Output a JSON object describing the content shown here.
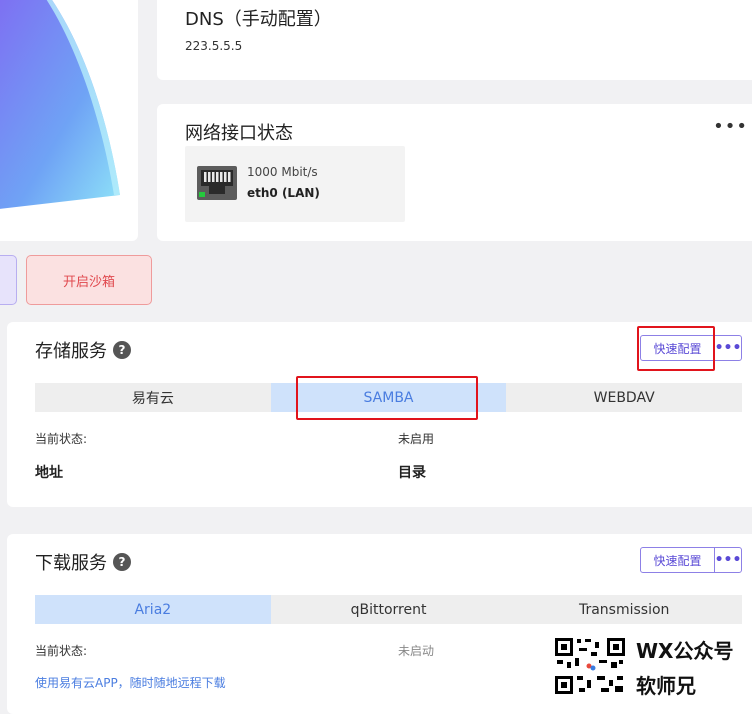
{
  "dns": {
    "title": "DNS（手动配置）",
    "value": "223.5.5.5"
  },
  "network": {
    "title": "网络接口状态",
    "port": {
      "speed": "1000 Mbit/s",
      "name": "eth0 (LAN)"
    }
  },
  "sandbox": {
    "button_label": "开启沙箱"
  },
  "storage": {
    "title": "存储服务",
    "quick_label": "快速配置",
    "tabs": [
      {
        "label": "易有云"
      },
      {
        "label": "SAMBA"
      },
      {
        "label": "WEBDAV"
      }
    ],
    "active_tab": "SAMBA",
    "status_label": "当前状态:",
    "status_value": "未启用",
    "col_address": "地址",
    "col_directory": "目录"
  },
  "download": {
    "title": "下载服务",
    "quick_label": "快速配置",
    "tabs": [
      {
        "label": "Aria2"
      },
      {
        "label": "qBittorrent"
      },
      {
        "label": "Transmission"
      }
    ],
    "active_tab": "Aria2",
    "status_label": "当前状态:",
    "status_value": "未启动",
    "app_link": "使用易有云APP，随时随地远程下载"
  },
  "watermark": {
    "line1": "WX公众号",
    "line2": "软师兄"
  },
  "colors": {
    "accent": "#5a4ad6",
    "tab_active_bg": "#cfe2fb",
    "tab_active_text": "#4a7de0",
    "danger": "#e0494e",
    "highlight_box": "#e1141c"
  }
}
